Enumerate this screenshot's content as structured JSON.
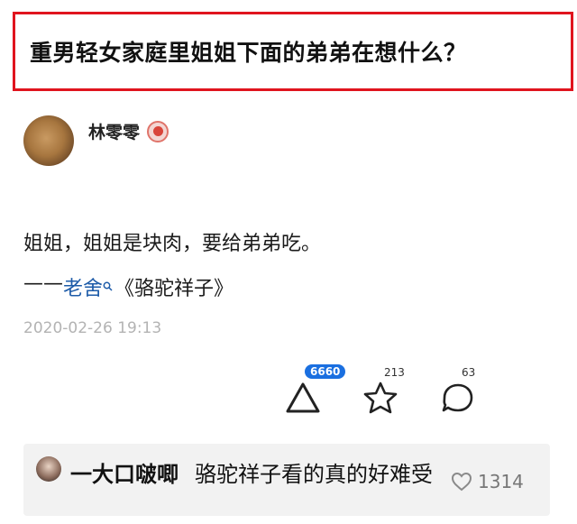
{
  "question": {
    "title": "重男轻女家庭里姐姐下面的弟弟在想什么？"
  },
  "author": {
    "name": "林零零",
    "avatar": "avatar-photo",
    "badge": "verified-badge-icon"
  },
  "answer": {
    "text": "姐姐，姐姐是块肉，要给弟弟吃。",
    "quote_dash": "——",
    "quote_author": "老舍",
    "quote_book": "《骆驼祥子》",
    "date": "2020-02-26 19:13"
  },
  "actions": {
    "upvote": {
      "icon": "upvote-triangle-icon",
      "count": "6660",
      "badge_color": "#1a6fe0"
    },
    "favorite": {
      "icon": "star-icon",
      "count": "213"
    },
    "comment": {
      "icon": "comment-bubble-icon",
      "count": "63"
    }
  },
  "top_comment": {
    "user": "一大口啵唧",
    "text": "骆驼祥子看的真的好难受",
    "like_icon": "heart-icon",
    "likes": "1314"
  },
  "colors": {
    "title_border": "#e0141e",
    "link": "#1d5ba8",
    "date": "#b3b3b3"
  }
}
